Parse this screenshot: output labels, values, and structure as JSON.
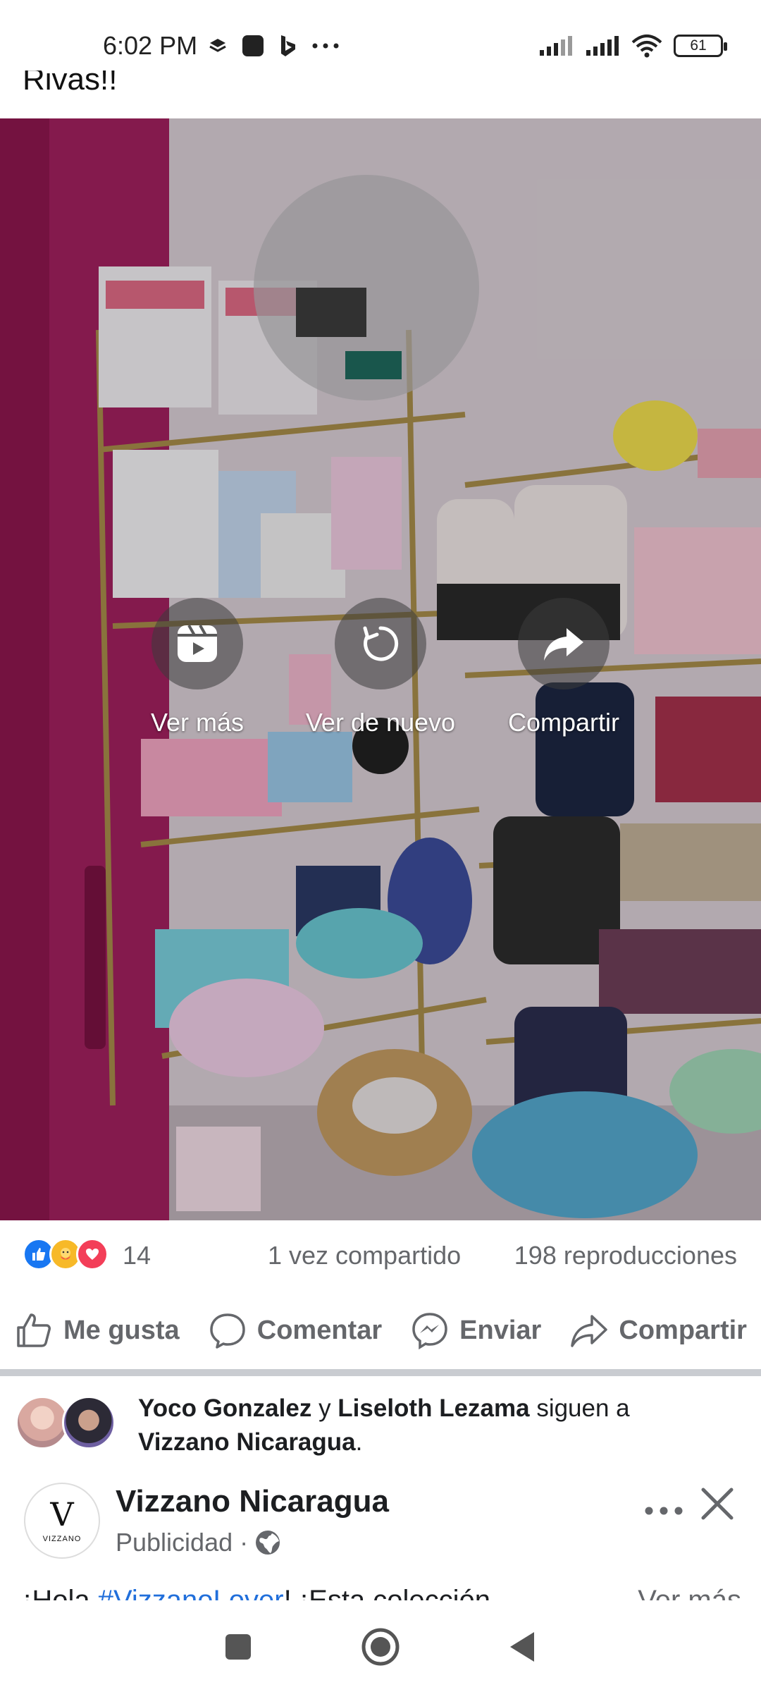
{
  "status_bar": {
    "time": "6:02 PM",
    "battery": "61",
    "icons": [
      "layers-icon",
      "app-square-icon",
      "bing-icon",
      "more-dots-icon",
      "signal-icon",
      "signal-icon",
      "wifi-icon",
      "battery-icon"
    ]
  },
  "post_prev": {
    "caption_tail": "Rivas!!"
  },
  "video": {
    "actions": [
      {
        "label": "Ver más",
        "icon": "reels-icon"
      },
      {
        "label": "Ver de nuevo",
        "icon": "replay-icon"
      },
      {
        "label": "Compartir",
        "icon": "share-arrow-icon"
      }
    ]
  },
  "engagement": {
    "reaction_count": "14",
    "shares": "1 vez compartido",
    "views": "198 reproducciones",
    "reaction_icons": [
      "like-icon",
      "care-icon",
      "love-icon"
    ]
  },
  "actions": {
    "like": "Me gusta",
    "comment": "Comentar",
    "send": "Enviar",
    "share": "Compartir"
  },
  "social_context": {
    "person1": "Yoco Gonzalez",
    "connector": " y ",
    "person2": "Liseloth Lezama",
    "verb": " siguen a ",
    "page": "Vizzano Nicaragua",
    "end": "."
  },
  "ad_post": {
    "page_name": "Vizzano Nicaragua",
    "sponsored": "Publicidad ·",
    "logo_letter": "V",
    "logo_word": "VIZZANO",
    "text_start": "¡Hola ",
    "hashtag": "#VizzanoLover",
    "text_rest": "! ¡Esta colección",
    "see_more": "... Ver más"
  },
  "colors": {
    "fb_blue": "#216fdb",
    "gray_text": "#65676b",
    "like_blue": "#1877f2",
    "love_red": "#f33e58",
    "care_yellow": "#f7b928"
  }
}
